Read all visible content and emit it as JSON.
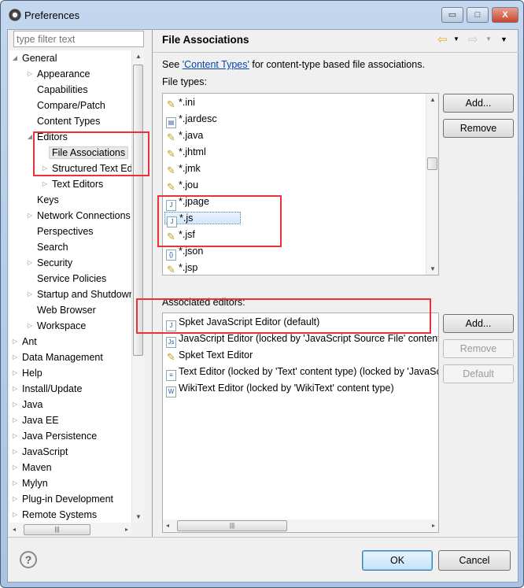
{
  "window": {
    "title": "Preferences",
    "minimize": "▭",
    "maximize": "□",
    "close": "X"
  },
  "filter": {
    "placeholder": "type filter text"
  },
  "tree": [
    {
      "label": "General",
      "level": 0,
      "expander": "◢"
    },
    {
      "label": "Appearance",
      "level": 1,
      "expander": "▷"
    },
    {
      "label": "Capabilities",
      "level": 1,
      "expander": ""
    },
    {
      "label": "Compare/Patch",
      "level": 1,
      "expander": ""
    },
    {
      "label": "Content Types",
      "level": 1,
      "expander": ""
    },
    {
      "label": "Editors",
      "level": 1,
      "expander": "◢"
    },
    {
      "label": "File Associations",
      "level": 2,
      "expander": "",
      "selected": true
    },
    {
      "label": "Structured Text Editors",
      "level": 2,
      "expander": "▷"
    },
    {
      "label": "Text Editors",
      "level": 2,
      "expander": "▷"
    },
    {
      "label": "Keys",
      "level": 1,
      "expander": ""
    },
    {
      "label": "Network Connections",
      "level": 1,
      "expander": "▷"
    },
    {
      "label": "Perspectives",
      "level": 1,
      "expander": ""
    },
    {
      "label": "Search",
      "level": 1,
      "expander": ""
    },
    {
      "label": "Security",
      "level": 1,
      "expander": "▷"
    },
    {
      "label": "Service Policies",
      "level": 1,
      "expander": ""
    },
    {
      "label": "Startup and Shutdown",
      "level": 1,
      "expander": "▷"
    },
    {
      "label": "Web Browser",
      "level": 1,
      "expander": ""
    },
    {
      "label": "Workspace",
      "level": 1,
      "expander": "▷"
    },
    {
      "label": "Ant",
      "level": 0,
      "expander": "▷"
    },
    {
      "label": "Data Management",
      "level": 0,
      "expander": "▷"
    },
    {
      "label": "Help",
      "level": 0,
      "expander": "▷"
    },
    {
      "label": "Install/Update",
      "level": 0,
      "expander": "▷"
    },
    {
      "label": "Java",
      "level": 0,
      "expander": "▷"
    },
    {
      "label": "Java EE",
      "level": 0,
      "expander": "▷"
    },
    {
      "label": "Java Persistence",
      "level": 0,
      "expander": "▷"
    },
    {
      "label": "JavaScript",
      "level": 0,
      "expander": "▷"
    },
    {
      "label": "Maven",
      "level": 0,
      "expander": "▷"
    },
    {
      "label": "Mylyn",
      "level": 0,
      "expander": "▷"
    },
    {
      "label": "Plug-in Development",
      "level": 0,
      "expander": "▷"
    },
    {
      "label": "Remote Systems",
      "level": 0,
      "expander": "▷"
    }
  ],
  "page": {
    "title": "File Associations",
    "desc_pre": "See ",
    "desc_link": "'Content Types'",
    "desc_post": " for content-type based file associations.",
    "file_types_label": "File types:",
    "associated_label": "Associated editors:"
  },
  "file_types": [
    {
      "label": "*.ini",
      "icon": "generic-file"
    },
    {
      "label": "*.jardesc",
      "icon": "jar-desc"
    },
    {
      "label": "*.java",
      "icon": "generic-file"
    },
    {
      "label": "*.jhtml",
      "icon": "generic-file"
    },
    {
      "label": "*.jmk",
      "icon": "generic-file"
    },
    {
      "label": "*.jou",
      "icon": "generic-file"
    },
    {
      "label": "*.jpage",
      "icon": "jpage"
    },
    {
      "label": "*.js",
      "icon": "js-file",
      "selected": true
    },
    {
      "label": "*.jsf",
      "icon": "generic-file"
    },
    {
      "label": "*.json",
      "icon": "json-file"
    },
    {
      "label": "*.jsp",
      "icon": "generic-file"
    }
  ],
  "editors": [
    {
      "label": "Spket JavaScript Editor (default)",
      "icon": "js-editor"
    },
    {
      "label": "JavaScript Editor (locked by 'JavaScript Source File' content type)",
      "icon": "js-source"
    },
    {
      "label": "Spket Text Editor",
      "icon": "generic-file"
    },
    {
      "label": "Text Editor (locked by 'Text' content type) (locked by 'JavaScript Source File' content type)",
      "icon": "text-file"
    },
    {
      "label": "WikiText Editor (locked by 'WikiText' content type)",
      "icon": "wiki"
    }
  ],
  "buttons": {
    "add": "Add...",
    "remove": "Remove",
    "add2": "Add...",
    "remove2": "Remove",
    "default": "Default",
    "ok": "OK",
    "cancel": "Cancel",
    "help": "?"
  },
  "nav": {
    "back": "⇦",
    "forward": "⇨",
    "dropdown": "▼",
    "menu": "▼"
  },
  "colors": {
    "highlight": "#e8333a",
    "accent": "#3c7fb1"
  }
}
